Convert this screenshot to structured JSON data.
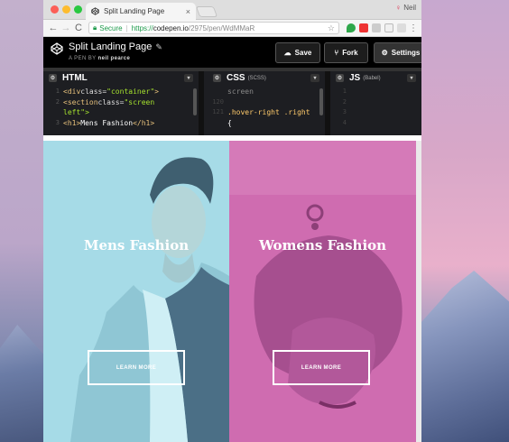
{
  "browser": {
    "tab_title": "Split Landing Page",
    "tab_close": "×",
    "profile_name": "Neil",
    "secure_label": "Secure",
    "url_scheme": "https://",
    "url_host": "codepen.io",
    "url_path": "/2975/pen/WdMMaR",
    "nav_back": "←",
    "nav_forward": "→",
    "nav_reload": "C",
    "star": "☆",
    "menu": "⋮"
  },
  "codepen": {
    "title": "Split Landing Page",
    "subtitle_prefix": "A PEN BY",
    "author": "neil pearce",
    "save_label": "Save",
    "fork_label": "Fork",
    "settings_label": "Settings"
  },
  "editors": {
    "html": {
      "title": "HTML",
      "lines": [
        {
          "n": "1",
          "tag_open": "<div ",
          "attr": "class=",
          "str": "\"container\"",
          "tag_close": ">"
        },
        {
          "n": "2",
          "tag_open": "  <section ",
          "attr": "class=",
          "str": "\"screen",
          "tag_close": ""
        },
        {
          "n": "",
          "cont": "left\">"
        },
        {
          "n": "3",
          "tag_open": "    <h1>",
          "txt": "Mens Fashion",
          "tag_close": "</h1>"
        }
      ]
    },
    "css": {
      "title": "CSS",
      "sub": "(SCSS)",
      "lines": [
        {
          "n": "",
          "code": "screen"
        },
        {
          "n": "120",
          "code": ""
        },
        {
          "n": "121",
          "code": ".hover-right .right"
        },
        {
          "n": "",
          "code": "{"
        }
      ]
    },
    "js": {
      "title": "JS",
      "sub": "(Babel)",
      "lines": [
        "1",
        "2",
        "3",
        "4"
      ]
    }
  },
  "landing": {
    "left_heading": "Mens Fashion",
    "right_heading": "Womens Fashion",
    "left_button": "LEARN MORE",
    "right_button": "LEARN MORE"
  }
}
